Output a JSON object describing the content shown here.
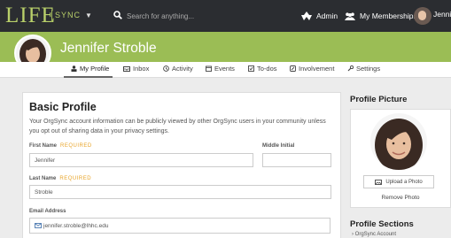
{
  "topbar": {
    "logo_main": "LIFE",
    "logo_sub": "SYNC",
    "search_placeholder": "Search for anything...",
    "admin_label": "Admin",
    "memberships_label": "My Memberships",
    "user_label": "Jennife"
  },
  "profile": {
    "name": "Jennifer Stroble"
  },
  "tabs": [
    {
      "label": "My Profile",
      "icon": "person-icon",
      "active": true
    },
    {
      "label": "Inbox",
      "icon": "inbox-icon"
    },
    {
      "label": "Activity",
      "icon": "activity-icon"
    },
    {
      "label": "Events",
      "icon": "calendar-icon"
    },
    {
      "label": "To-dos",
      "icon": "checkbox-icon"
    },
    {
      "label": "Involvement",
      "icon": "involvement-icon"
    },
    {
      "label": "Settings",
      "icon": "wrench-icon"
    }
  ],
  "basic_profile": {
    "title": "Basic Profile",
    "description": "Your OrgSync account information can be publicly viewed by other OrgSync users in your community unless you opt out of sharing data in your privacy settings.",
    "first_name_label": "First Name",
    "first_name_required": "REQUIRED",
    "first_name_value": "Jennifer",
    "middle_initial_label": "Middle Initial",
    "middle_initial_value": "",
    "last_name_label": "Last Name",
    "last_name_required": "REQUIRED",
    "last_name_value": "Stroble",
    "email_label": "Email Address",
    "email_value": "jennifer.stroble@lhhc.edu"
  },
  "profile_picture": {
    "title": "Profile Picture",
    "upload_label": "Upload a Photo",
    "remove_label": "Remove Photo"
  },
  "profile_sections": {
    "title": "Profile Sections",
    "first_item": "OrgSync Account"
  },
  "colors": {
    "topbar": "#2b2d31",
    "banner": "#9bbd55",
    "logo": "#b9d06a",
    "required": "#e8a52a"
  }
}
